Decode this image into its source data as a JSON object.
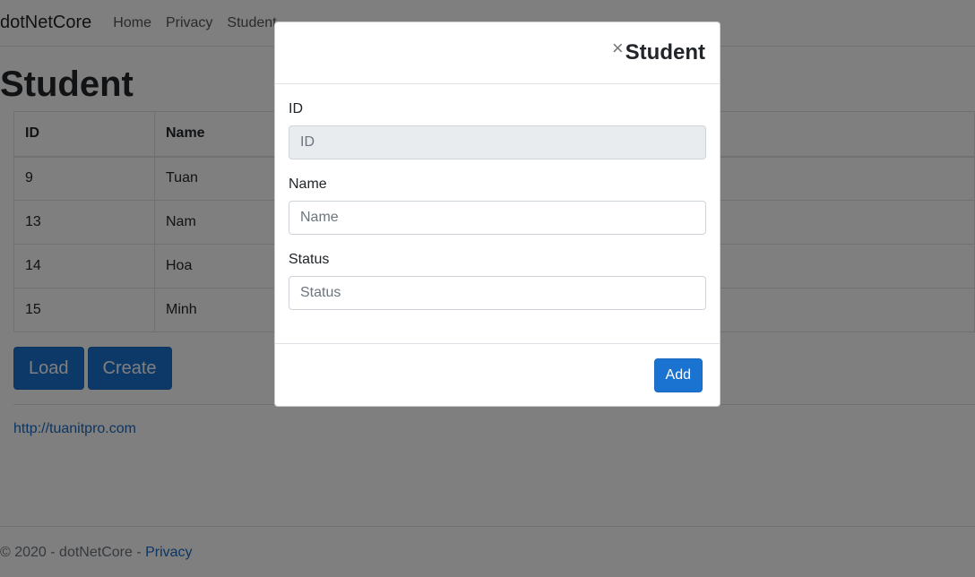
{
  "navbar": {
    "brand": "dotNetCore",
    "links": [
      "Home",
      "Privacy",
      "Student"
    ]
  },
  "page": {
    "title": "Student"
  },
  "table": {
    "headers": [
      "ID",
      "Name"
    ],
    "rows": [
      {
        "id": "9",
        "name": "Tuan"
      },
      {
        "id": "13",
        "name": "Nam"
      },
      {
        "id": "14",
        "name": "Hoa"
      },
      {
        "id": "15",
        "name": "Minh"
      }
    ]
  },
  "buttons": {
    "load": "Load",
    "create": "Create"
  },
  "site_link": "http://tuanitpro.com",
  "footer": {
    "copyright": "© 2020 - dotNetCore - ",
    "privacy": "Privacy"
  },
  "modal": {
    "close_glyph": "×",
    "title": "Student",
    "fields": {
      "id": {
        "label": "ID",
        "placeholder": "ID",
        "value": ""
      },
      "name": {
        "label": "Name",
        "placeholder": "Name",
        "value": ""
      },
      "status": {
        "label": "Status",
        "placeholder": "Status",
        "value": ""
      }
    },
    "add_label": "Add"
  },
  "colors": {
    "primary": "#1a73d0",
    "backdrop": "rgba(0,0,0,0.5)"
  }
}
